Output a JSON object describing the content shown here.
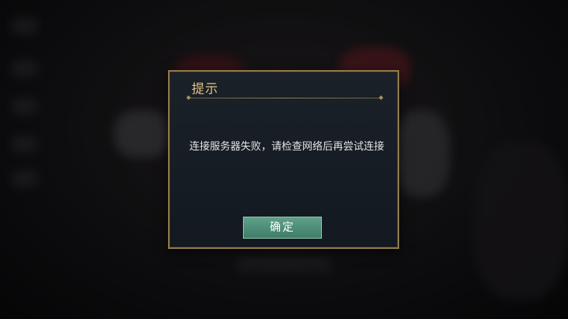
{
  "dialog": {
    "title": "提示",
    "message": "连接服务器失败，请检查网络后再尝试连接",
    "confirm_label": "确定"
  },
  "colors": {
    "dialog_border": "#8f7a4e",
    "dialog_background": "#161d24",
    "title_text": "#e3c48a",
    "button_background": "#4f8f78"
  }
}
